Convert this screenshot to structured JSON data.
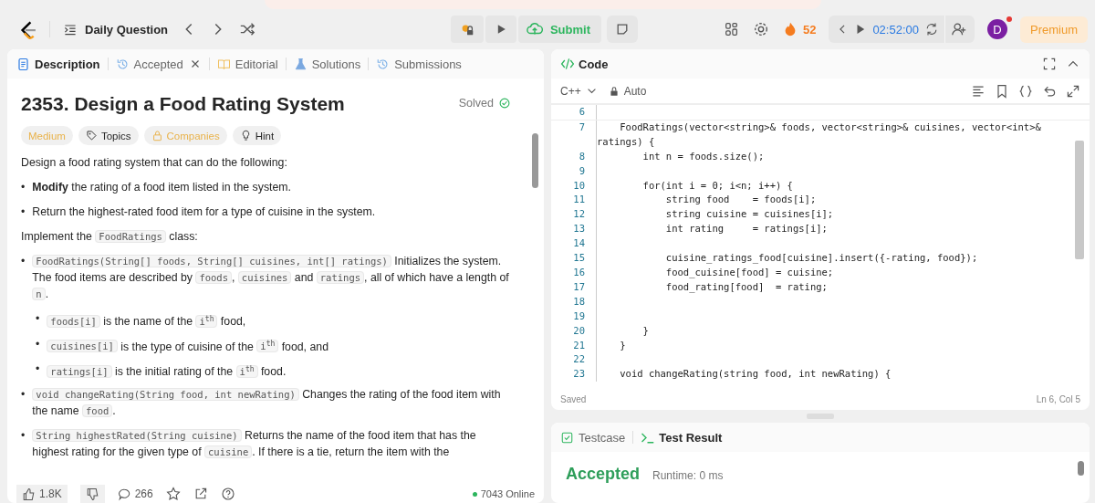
{
  "nav": {
    "title": "Daily Question",
    "submit": "Submit",
    "streak": "52",
    "timer": "02:52:00",
    "avatar": "D",
    "premium": "Premium"
  },
  "tabs": [
    {
      "label": "Description",
      "selected": true,
      "kind": "description"
    },
    {
      "label": "Accepted",
      "selected": false,
      "kind": "accepted"
    },
    {
      "label": "Editorial",
      "selected": false,
      "kind": "editorial"
    },
    {
      "label": "Solutions",
      "selected": false,
      "kind": "solutions"
    },
    {
      "label": "Submissions",
      "selected": false,
      "kind": "submissions"
    }
  ],
  "problem": {
    "title": "2353. Design a Food Rating System",
    "status": "Solved",
    "tags": [
      {
        "label": "Medium",
        "kind": "difficulty"
      },
      {
        "label": "Topics",
        "kind": "topics"
      },
      {
        "label": "Companies",
        "kind": "companies"
      },
      {
        "label": "Hint",
        "kind": "hint"
      }
    ],
    "body": [
      {
        "kind": "para",
        "parts": [
          {
            "kind": "text",
            "text": "Design a food rating system that can do the following:"
          }
        ]
      },
      {
        "kind": "bullet",
        "marker": "•",
        "parts": [
          {
            "kind": "text",
            "text": "**Modify** the rating of a food item listed in the system."
          }
        ]
      },
      {
        "kind": "bullet",
        "marker": "•",
        "parts": [
          {
            "kind": "text",
            "text": "Return the highest-rated food item for a type of cuisine in the system."
          }
        ]
      },
      {
        "kind": "para",
        "parts": [
          {
            "kind": "text",
            "text": "Implement the "
          },
          {
            "kind": "code",
            "text": "FoodRatings"
          },
          {
            "kind": "text",
            "text": " class:"
          }
        ]
      },
      {
        "kind": "bullet",
        "marker": "•",
        "parts": [
          {
            "kind": "code",
            "text": "FoodRatings(String[] foods, String[] cuisines, int[] ratings)"
          },
          {
            "kind": "text",
            "text": " Initializes the system. The food items are described by "
          },
          {
            "kind": "code",
            "text": "foods"
          },
          {
            "kind": "text",
            "text": ", "
          },
          {
            "kind": "code",
            "text": "cuisines"
          },
          {
            "kind": "text",
            "text": " and "
          },
          {
            "kind": "code",
            "text": "ratings"
          },
          {
            "kind": "text",
            "text": ", all of which have a length of "
          },
          {
            "kind": "code",
            "text": "n"
          },
          {
            "kind": "text",
            "text": "."
          }
        ]
      },
      {
        "kind": "subbullet",
        "marker": "•",
        "parts": [
          {
            "kind": "code",
            "text": "foods[i]"
          },
          {
            "kind": "text",
            "text": " is the name of the "
          },
          {
            "kind": "code",
            "text": "i$^{th}$"
          },
          {
            "kind": "text",
            "text": " food,"
          }
        ]
      },
      {
        "kind": "subbullet",
        "marker": "•",
        "parts": [
          {
            "kind": "code",
            "text": "cuisines[i]"
          },
          {
            "kind": "text",
            "text": " is the type of cuisine of the "
          },
          {
            "kind": "code",
            "text": "i$^{th}$"
          },
          {
            "kind": "text",
            "text": " food, and"
          }
        ]
      },
      {
        "kind": "subbullet",
        "marker": "•",
        "parts": [
          {
            "kind": "code",
            "text": "ratings[i]"
          },
          {
            "kind": "text",
            "text": " is the initial rating of the "
          },
          {
            "kind": "code",
            "text": "i$^{th}$"
          },
          {
            "kind": "text",
            "text": " food."
          }
        ]
      },
      {
        "kind": "bullet",
        "marker": "•",
        "parts": [
          {
            "kind": "code",
            "text": "void changeRating(String food, int newRating)"
          },
          {
            "kind": "text",
            "text": " Changes the rating of the food item with the name "
          },
          {
            "kind": "code",
            "text": "food"
          },
          {
            "kind": "text",
            "text": "."
          }
        ]
      },
      {
        "kind": "bullet",
        "marker": "•",
        "parts": [
          {
            "kind": "code",
            "text": "String highestRated(String cuisine)"
          },
          {
            "kind": "text",
            "text": " Returns the name of the food item that has the highest rating for the given type of "
          },
          {
            "kind": "code",
            "text": "cuisine"
          },
          {
            "kind": "text",
            "text": ". If there is a tie, return the item with the"
          }
        ]
      }
    ],
    "footer": {
      "likes": "1.8K",
      "comments": "266",
      "online": "7043 Online"
    }
  },
  "code": {
    "title": "Code",
    "language": "C++",
    "mode": "Auto",
    "status": "Saved",
    "cursor": "Ln 6, Col 5",
    "lines": [
      {
        "n": "6",
        "current": true
      },
      {
        "n": "7",
        "text": "    FoodRatings(vector<string>& foods, vector<string>& cuisines, vector<int>& ratings) {",
        "current": false
      },
      {
        "n": "8",
        "text": "        int n = foods.size();",
        "current": false
      },
      {
        "n": "9",
        "current": false
      },
      {
        "n": "10",
        "text": "        for(int i = 0; i<n; i++) {",
        "current": false
      },
      {
        "n": "11",
        "text": "            string food    = foods[i];",
        "current": false
      },
      {
        "n": "12",
        "text": "            string cuisine = cuisines[i];",
        "current": false
      },
      {
        "n": "13",
        "text": "            int rating     = ratings[i];",
        "current": false
      },
      {
        "n": "14",
        "current": false
      },
      {
        "n": "15",
        "text": "            cuisine_ratings_food[cuisine].insert({-rating, food});",
        "current": false
      },
      {
        "n": "16",
        "text": "            food_cuisine[food] = cuisine;",
        "current": false
      },
      {
        "n": "17",
        "text": "            food_rating[food]  = rating;",
        "current": false
      },
      {
        "n": "18",
        "current": false
      },
      {
        "n": "19",
        "current": false
      },
      {
        "n": "20",
        "text": "        }",
        "current": false
      },
      {
        "n": "21",
        "text": "    }",
        "current": false
      },
      {
        "n": "22",
        "current": false
      },
      {
        "n": "23",
        "text": "    void changeRating(string food, int newRating) {",
        "current": false
      }
    ]
  },
  "result": {
    "tabs": [
      {
        "label": "Testcase",
        "selected": false,
        "kind": "testcase"
      },
      {
        "label": "Test Result",
        "selected": true,
        "kind": "result"
      }
    ],
    "verdict": "Accepted",
    "runtime": "Runtime: 0 ms"
  }
}
